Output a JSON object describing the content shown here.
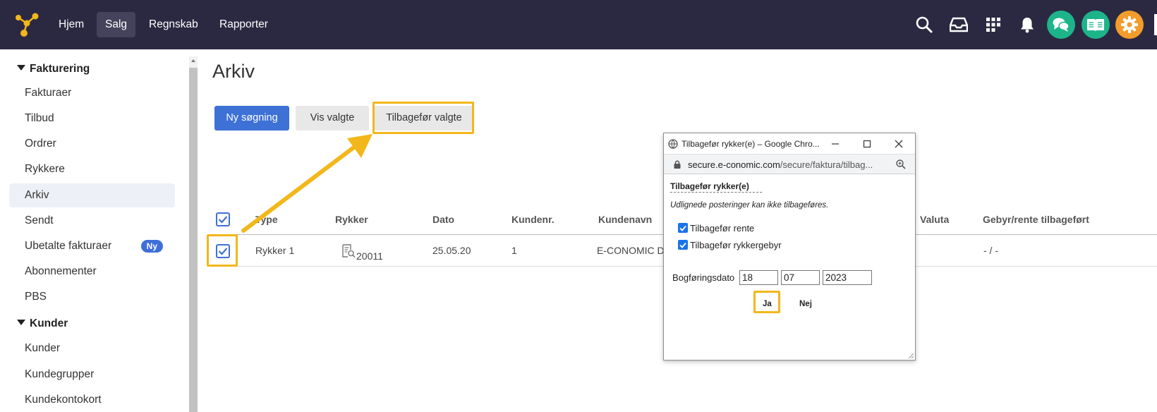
{
  "nav": {
    "items": [
      {
        "label": "Hjem",
        "active": false
      },
      {
        "label": "Salg",
        "active": true
      },
      {
        "label": "Regnskab",
        "active": false
      },
      {
        "label": "Rapporter",
        "active": false
      }
    ],
    "icons": [
      "search-icon",
      "inbox-icon",
      "apps-grid-icon",
      "bell-icon",
      "chat-icon",
      "book-icon",
      "gear-icon"
    ],
    "colors": {
      "bar": "#2b2942",
      "chat": "#1db48a",
      "book": "#1db48a",
      "gear": "#f29d2b",
      "logo": "#f2b71a"
    }
  },
  "sidebar": {
    "sections": [
      {
        "title": "Fakturering",
        "items": [
          "Fakturaer",
          "Tilbud",
          "Ordrer",
          "Rykkere",
          "Arkiv",
          "Sendt",
          "Ubetalte fakturaer",
          "Abonnementer",
          "PBS"
        ]
      },
      {
        "title": "Kunder",
        "items": [
          "Kunder",
          "Kundegrupper",
          "Kundekontokort"
        ]
      }
    ],
    "active_item": "Arkiv",
    "badge": "Ny"
  },
  "main": {
    "title": "Arkiv",
    "buttons": {
      "new_search": "Ny søgning",
      "show_selected": "Vis valgte",
      "revert_selected": "Tilbagefør valgte"
    },
    "table": {
      "headers": [
        "Type",
        "Rykker",
        "Dato",
        "Kundenr.",
        "Kundenavn",
        "Valuta",
        "Gebyr/rente tilbageført"
      ],
      "rows": [
        {
          "type": "Rykker 1",
          "rykker": "20011",
          "dato": "25.05.20",
          "kundenr": "1",
          "kundenavn": "E-CONOMIC DA",
          "valuta": "",
          "gebyr": "- / -",
          "selected": true
        }
      ]
    }
  },
  "popup": {
    "window_title": "Tilbagefør rykker(e) – Google Chro...",
    "url_host": "secure.e-conomic.com",
    "url_path": "/secure/faktura/tilbag...",
    "heading": "Tilbagefør rykker(e)",
    "note": "Udlignede posteringer kan ikke tilbageføres.",
    "checkboxes": [
      {
        "label": "Tilbagefør rente",
        "checked": true
      },
      {
        "label": "Tilbagefør rykkergebyr",
        "checked": true
      }
    ],
    "date_label": "Bogføringsdato",
    "date": {
      "day": "18",
      "month": "07",
      "year": "2023"
    },
    "yes": "Ja",
    "no": "Nej"
  },
  "highlight_color": "#f2b71a"
}
